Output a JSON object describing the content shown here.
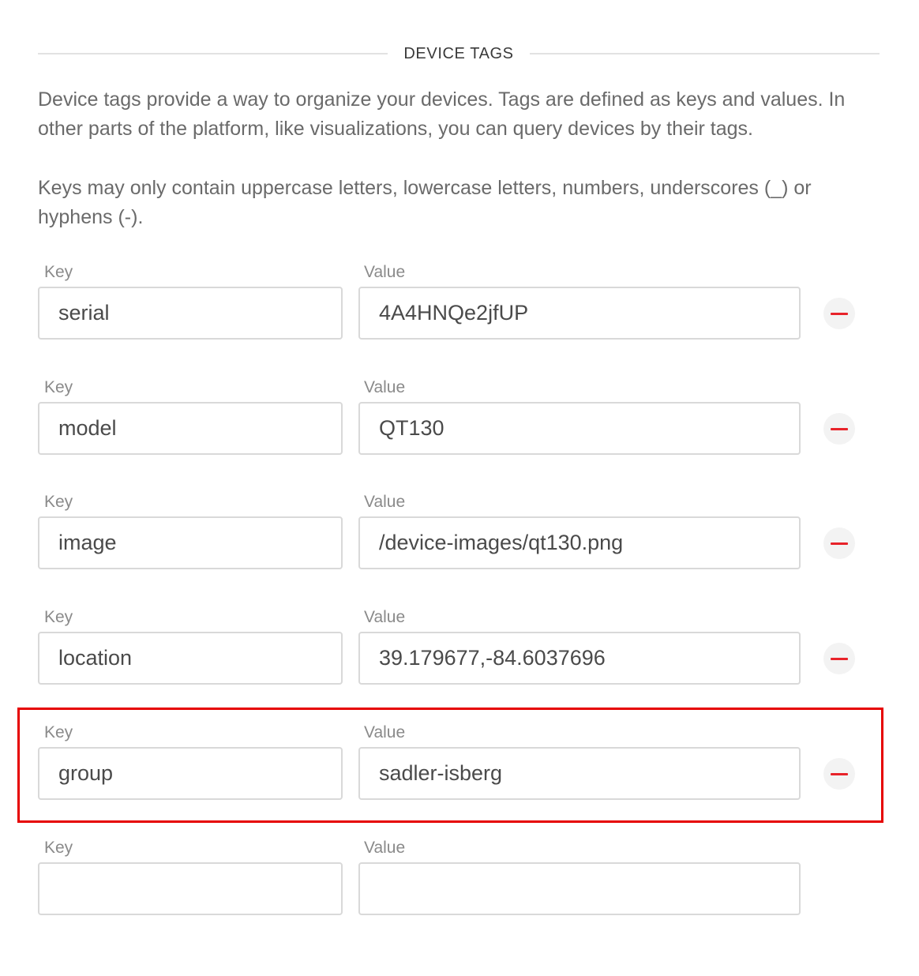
{
  "section": {
    "title": "DEVICE TAGS"
  },
  "description": {
    "paragraph1": "Device tags provide a way to organize your devices. Tags are defined as keys and values. In other parts of the platform, like visualizations, you can query devices by their tags.",
    "paragraph2": "Keys may only contain uppercase letters, lowercase letters, numbers, underscores (_) or hyphens (-)."
  },
  "labels": {
    "key": "Key",
    "value": "Value"
  },
  "tags": [
    {
      "key": "serial",
      "value": "4A4HNQe2jfUP"
    },
    {
      "key": "model",
      "value": "QT130"
    },
    {
      "key": "image",
      "value": "/device-images/qt130.png"
    },
    {
      "key": "location",
      "value": "39.179677,-84.6037696"
    },
    {
      "key": "group",
      "value": "sadler-isberg"
    },
    {
      "key": "",
      "value": ""
    }
  ],
  "icons": {
    "remove": "minus-circle-icon"
  },
  "colors": {
    "remove_icon": "#e8232a",
    "highlight_border": "#e60000"
  }
}
